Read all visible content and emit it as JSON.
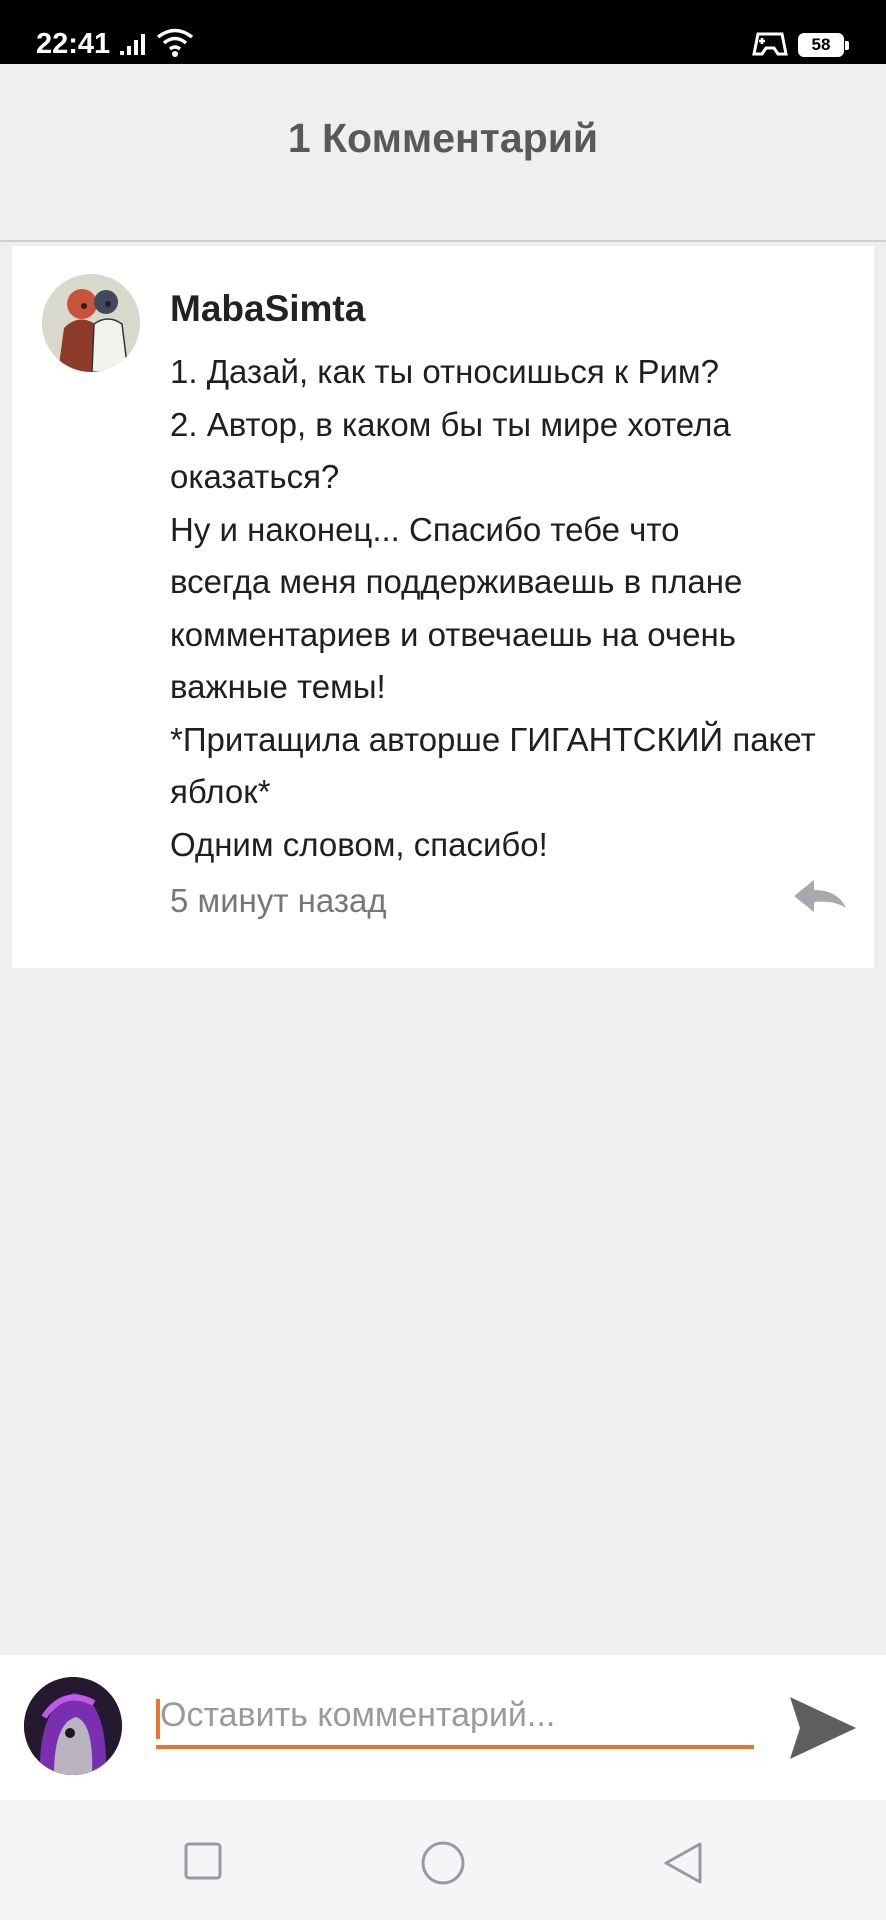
{
  "status_bar": {
    "time": "22:41",
    "battery": "58",
    "icons": [
      "signal-icon",
      "wifi-icon",
      "gamepad-icon",
      "battery-icon"
    ]
  },
  "header": {
    "title": "1 Комментарий"
  },
  "comment": {
    "author": "MabaSimta",
    "lines": [
      "1. Дазай, как ты относишься к Рим?",
      "2. Автор, в каком бы ты мире хотела",
      "оказаться?",
      "Ну и наконец... Спасибо тебе что",
      "всегда меня поддерживаешь в плане",
      "комментариев и отвечаешь на очень",
      "важные темы!",
      "*Притащила авторше ГИГАНТСКИЙ пакет",
      "яблок*",
      "Одним словом, спасибо!"
    ],
    "time": "5 минут назад",
    "reply_icon": "reply-icon"
  },
  "composer": {
    "placeholder": "Оставить комментарий...",
    "send_icon": "send-icon"
  },
  "nav_bar": {
    "icons": [
      "recent-apps-icon",
      "home-icon",
      "back-icon"
    ]
  },
  "colors": {
    "accent": "#e8742f",
    "background": "#efeef1",
    "card": "#ffffff",
    "status_bar": "#000000"
  }
}
